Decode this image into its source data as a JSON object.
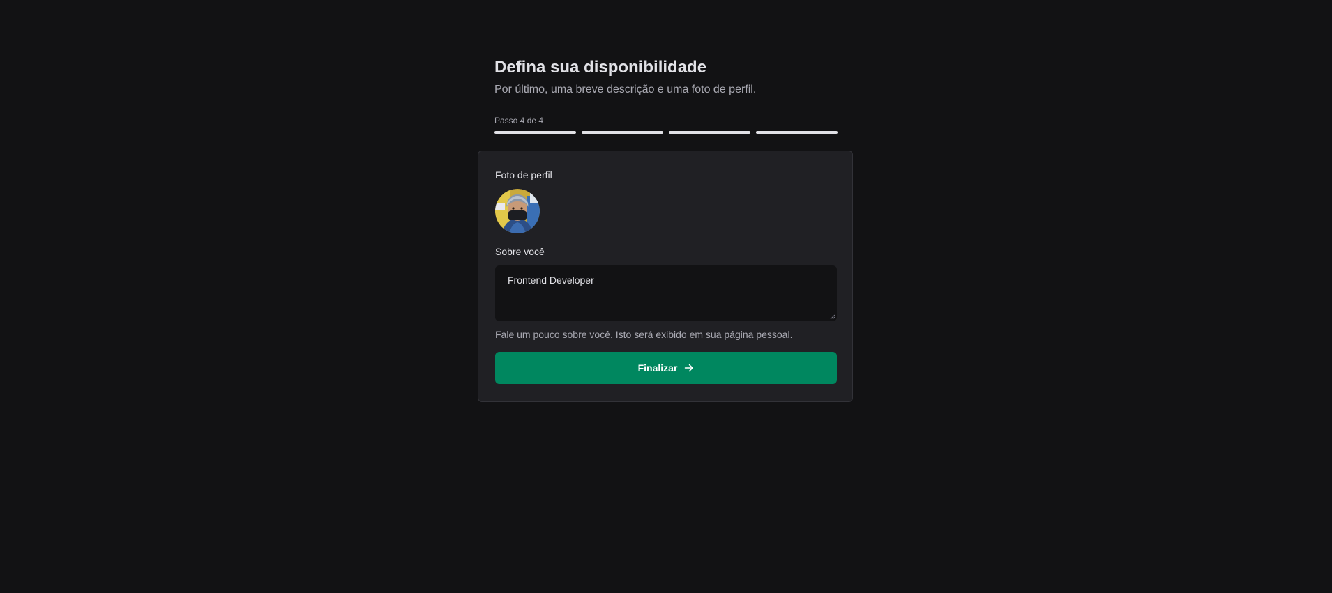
{
  "header": {
    "title": "Defina sua disponibilidade",
    "subtitle": "Por último, uma breve descrição e uma foto de perfil."
  },
  "progress": {
    "label": "Passo 4 de 4",
    "current_step": 4,
    "total_steps": 4
  },
  "form": {
    "photo_label": "Foto de perfil",
    "about_label": "Sobre você",
    "about_value": "Frontend Developer",
    "about_hint": "Fale um pouco sobre você. Isto será exibido em sua página pessoal.",
    "submit_label": "Finalizar",
    "submit_icon": "arrow-right-icon"
  },
  "colors": {
    "background": "#121214",
    "card": "#202024",
    "accent": "#00875f",
    "text": "#e1e1e6",
    "muted": "#a9a9b2"
  }
}
